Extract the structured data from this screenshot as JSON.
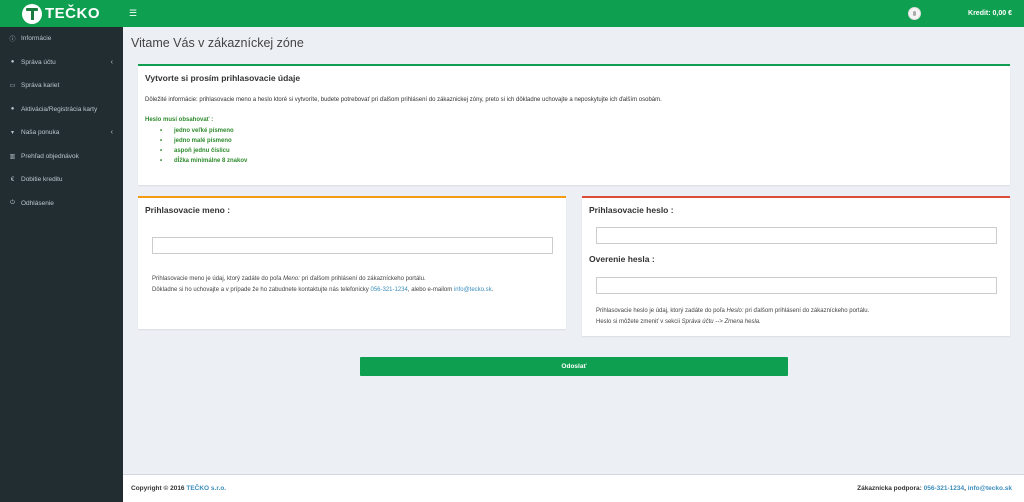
{
  "logo": {
    "text": "TEČKO"
  },
  "topbar": {
    "credit": "Kredit: 0,00 €"
  },
  "sidebar": {
    "items": [
      {
        "label": "Informácie",
        "icon": "info-icon"
      },
      {
        "label": "Správa účtu",
        "icon": "user-icon"
      },
      {
        "label": "Správa kariet",
        "icon": "card-icon"
      },
      {
        "label": "Aktivácia/Registrácia karty",
        "icon": "user-plus-icon"
      },
      {
        "label": "Naša ponuka",
        "icon": "cart-icon"
      },
      {
        "label": "Prehľad objednávok",
        "icon": "bar-chart-icon"
      },
      {
        "label": "Dobitie kreditu",
        "icon": "euro-icon"
      },
      {
        "label": "Odhlásenie",
        "icon": "power-icon"
      }
    ]
  },
  "page": {
    "title": "Vitame Vás v zákazníckej zóne"
  },
  "intro": {
    "title": "Vytvorte si prosím prihlasovacie údaje",
    "info": "Dôležité informácie: prihlasovacie meno a heslo ktoré si vytvoríte, budete potrebovať pri ďalšom prihlásení do zákaznickej zóny, preto si ich dôkladne uchovajte a neposkytujte ich ďalším osobám.",
    "rules_heading": "Heslo musí obsahovať :",
    "rules": [
      "jedno veľké písmeno",
      "jedno malé písmeno",
      "aspoň jednu číslicu",
      "dĺžka minimálne 8 znakov"
    ]
  },
  "username": {
    "title": "Prihlasovacie meno :",
    "value": "",
    "help1_a": "Prihlasovacie meno je údaj, ktorý zadáte do poľa ",
    "help1_b": "Meno:",
    "help1_c": " pri ďalšom prihlásení do zákazníckeho portálu.",
    "help2_a": "Dôkladne si ho uchovajte a v prípade že ho zabudnete kontaktujte nás telefonicky ",
    "help2_phone": "056-321-1234",
    "help2_b": ", alebo e-mailom ",
    "help2_email": "info@tecko.sk",
    "help2_c": "."
  },
  "password": {
    "title": "Prihlasovacie heslo :",
    "value": "",
    "confirm_title": "Overenie hesla :",
    "confirm_value": "",
    "help1_a": "Prihlasovacie heslo je údaj, ktorý zadáte do poľa ",
    "help1_b": "Heslo:",
    "help1_c": " pri ďalšom prihlásení do zákazníckeho portálu.",
    "help2_a": "Heslo si môžete zmeniť v sekcii ",
    "help2_b": "Správa účtu --> Zmena hesla."
  },
  "submit": {
    "label": "Odoslať"
  },
  "footer": {
    "copy_a": "Copyright © 2016 ",
    "copy_brand": "TEČKO s.r.o.",
    "support_a": "Zákaznícka podpora: ",
    "support_phone": "056-321-1234",
    "support_sep": ", ",
    "support_email": "info@tecko.sk"
  },
  "colors": {
    "brand": "#0f9f50",
    "sidebar": "#222d32",
    "warning": "#f39c12",
    "danger": "#dd4b39",
    "link": "#3c8dbc"
  }
}
